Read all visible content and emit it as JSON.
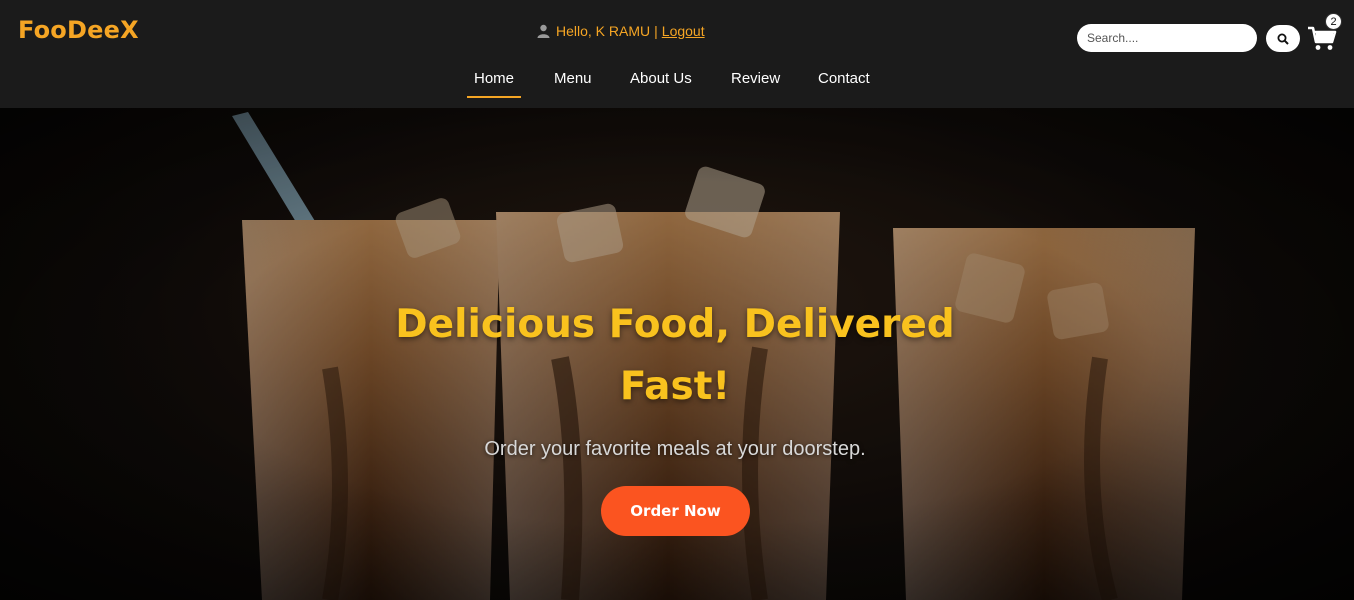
{
  "brand": {
    "logo": "FooDeeX"
  },
  "user_bar": {
    "greeting": "Hello, K RAMU",
    "separator": "|",
    "logout": "Logout"
  },
  "search": {
    "placeholder": "Search...."
  },
  "cart": {
    "count": "2"
  },
  "nav": {
    "items": [
      {
        "label": "Home",
        "active": true
      },
      {
        "label": "Menu"
      },
      {
        "label": "About Us"
      },
      {
        "label": "Review"
      },
      {
        "label": "Contact"
      }
    ]
  },
  "hero": {
    "title": "Delicious Food, Delivered Fast!",
    "subtitle": "Order your favorite meals at your doorstep.",
    "cta": "Order Now"
  },
  "colors": {
    "accent": "#f5a524",
    "title": "#f9c21e",
    "cta": "#fb5420",
    "header_bg": "#1b1b1b"
  }
}
